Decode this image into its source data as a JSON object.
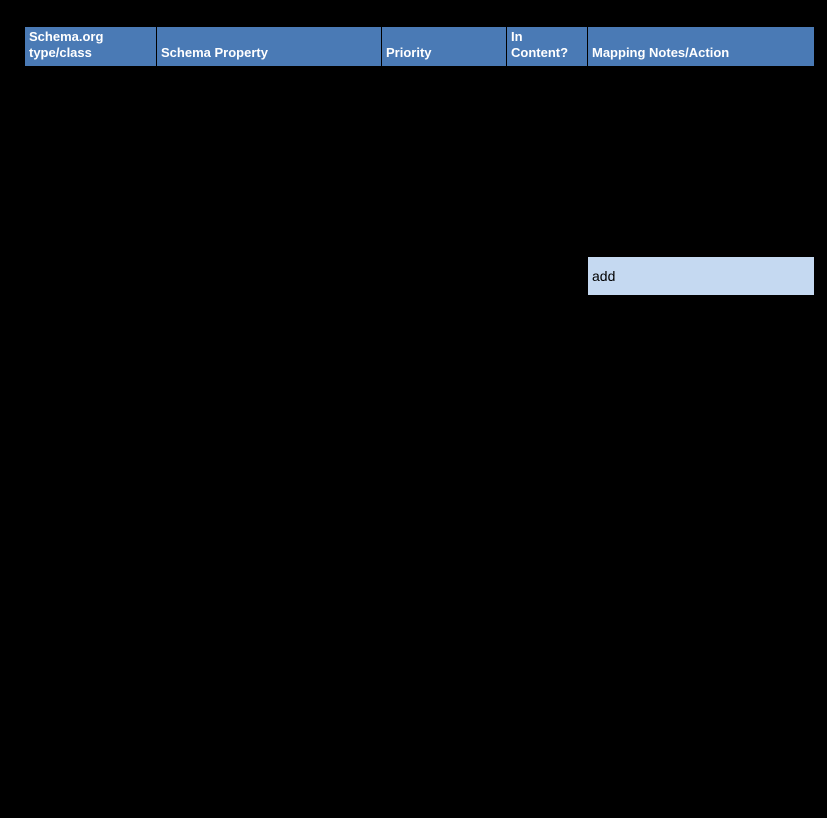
{
  "table": {
    "headers": {
      "type": "Schema.org type/class",
      "property": "Schema Property",
      "priority": "Priority",
      "inContent": "In Content?",
      "mapping": "Mapping Notes/Action"
    },
    "rows": [
      {},
      {},
      {},
      {},
      {},
      {},
      {},
      {},
      {},
      {},
      {
        "mapping": "add",
        "highlight": true
      },
      {},
      {},
      {},
      {},
      {},
      {},
      {},
      {},
      {},
      {},
      {},
      {},
      {},
      {},
      {},
      {},
      {},
      {},
      {},
      {},
      {},
      {},
      {},
      {},
      {},
      {},
      {}
    ]
  }
}
